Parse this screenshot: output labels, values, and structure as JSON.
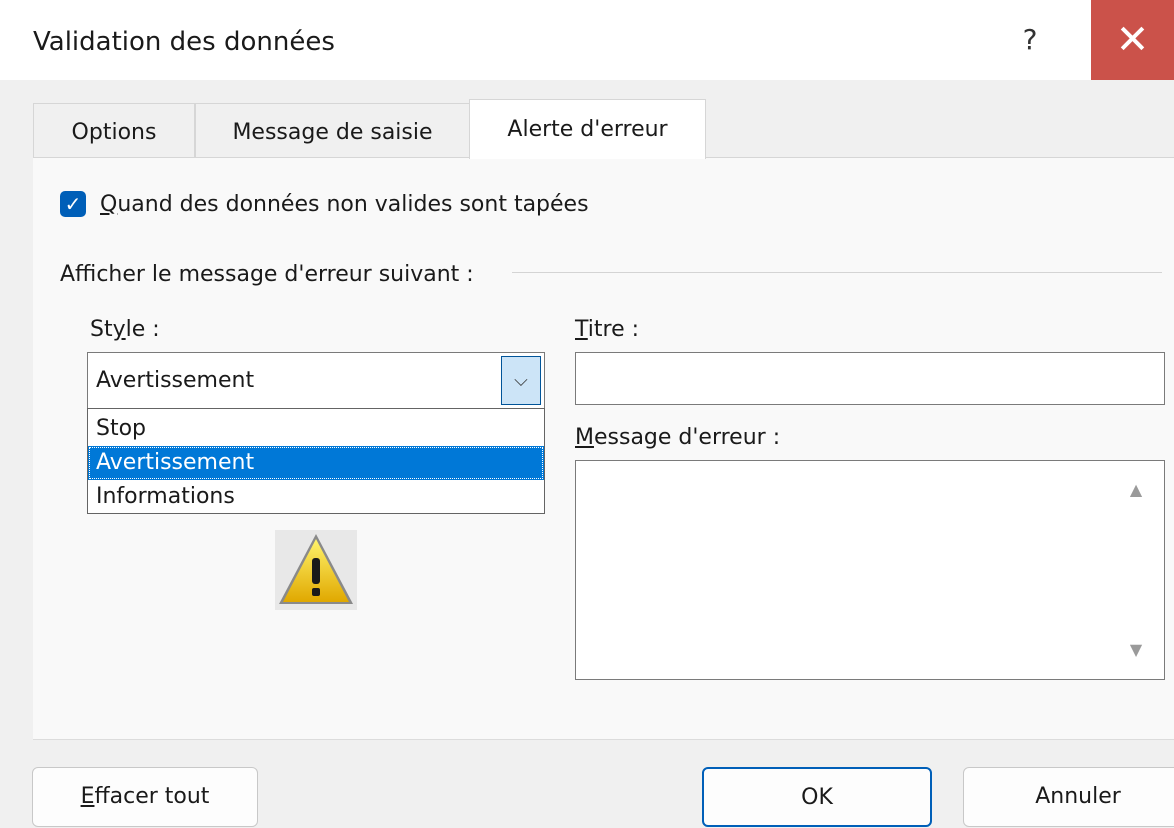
{
  "window": {
    "title": "Validation des données",
    "help_label": "?",
    "close_label": "✕"
  },
  "tabs": [
    {
      "label": "Options",
      "selected": false
    },
    {
      "label": "Message de saisie",
      "selected": false
    },
    {
      "label": "Alerte d'erreur",
      "selected": true
    }
  ],
  "alert": {
    "checkbox": {
      "label_ul": "Q",
      "label_rest": "uand des données non valides sont tapées",
      "checked": true
    },
    "group_label": "Afficher le message d'erreur suivant :",
    "style": {
      "label_pre": "St",
      "label_ul": "y",
      "label_rest": "le :",
      "value": "Avertissement",
      "options": [
        "Stop",
        "Avertissement",
        "Informations"
      ],
      "highlighted": "Avertissement",
      "icon": "warning-icon"
    },
    "titre": {
      "label_ul": "T",
      "label_rest": "itre :",
      "value": ""
    },
    "message": {
      "label_ul": "M",
      "label_rest": "essage d'erreur :",
      "value": ""
    }
  },
  "buttons": {
    "clear": {
      "label_ul": "E",
      "label_rest": "ffacer tout"
    },
    "ok": "OK",
    "cancel": "Annuler"
  },
  "colors": {
    "accent": "#005fb8",
    "close_bg": "#cb524a",
    "selection": "#0078d7"
  }
}
